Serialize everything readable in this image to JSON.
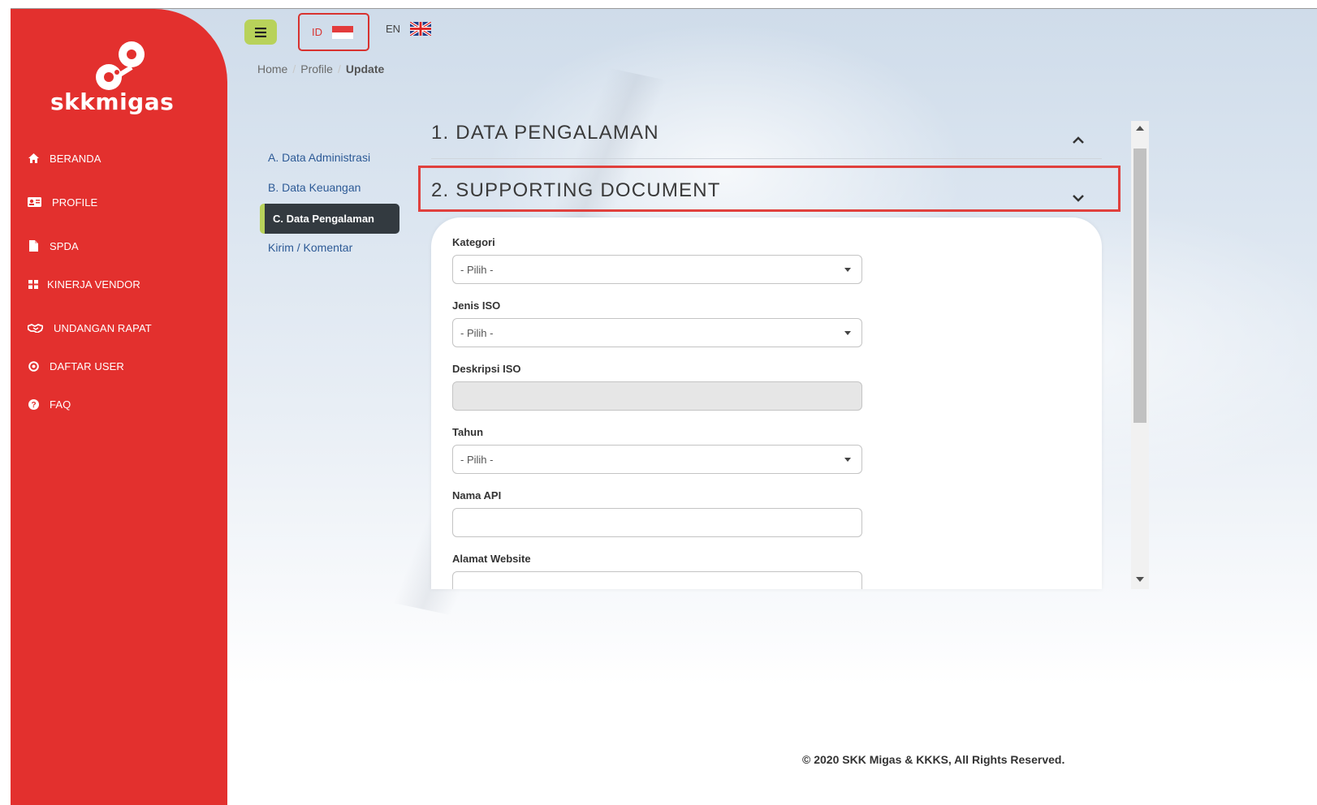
{
  "brand": {
    "name": "skkmigas",
    "color": "#e3302e",
    "accent": "#b8d25a"
  },
  "sidebar": {
    "items": [
      {
        "label": "BERANDA",
        "icon": "home-icon"
      },
      {
        "label": "PROFILE",
        "icon": "id-card-icon"
      },
      {
        "label": "SPDA",
        "icon": "file-icon"
      },
      {
        "label": "KINERJA VENDOR",
        "icon": "grid-icon"
      },
      {
        "label": "UNDANGAN RAPAT",
        "icon": "handshake-icon"
      },
      {
        "label": "DAFTAR USER",
        "icon": "target-icon"
      },
      {
        "label": "FAQ",
        "icon": "question-icon"
      }
    ]
  },
  "topbar": {
    "menu_icon": "hamburger-icon",
    "languages": [
      {
        "code": "ID",
        "flag": "indonesia-flag-icon",
        "selected": true
      },
      {
        "code": "EN",
        "flag": "uk-flag-icon",
        "selected": false
      }
    ]
  },
  "breadcrumb": {
    "items": [
      "Home",
      "Profile",
      "Update"
    ]
  },
  "subnav": {
    "items": [
      "A. Data Administrasi",
      "B. Data Keuangan",
      "C. Data Pengalaman",
      "Kirim / Komentar"
    ],
    "active_index": 2
  },
  "sections": [
    {
      "title": "1. DATA PENGALAMAN",
      "state": "expanded"
    },
    {
      "title": "2. SUPPORTING DOCUMENT",
      "state": "collapsed"
    }
  ],
  "form": {
    "fields": [
      {
        "label": "Kategori",
        "type": "select",
        "value": "- Pilih -"
      },
      {
        "label": "Jenis ISO",
        "type": "select",
        "value": "- Pilih -"
      },
      {
        "label": "Deskripsi ISO",
        "type": "text",
        "value": "",
        "disabled": true
      },
      {
        "label": "Tahun",
        "type": "select",
        "value": "- Pilih -"
      },
      {
        "label": "Nama API",
        "type": "text",
        "value": ""
      },
      {
        "label": "Alamat Website",
        "type": "text",
        "value": ""
      }
    ]
  },
  "footer": {
    "text": "© 2020 SKK Migas & KKKS, All Rights Reserved."
  }
}
